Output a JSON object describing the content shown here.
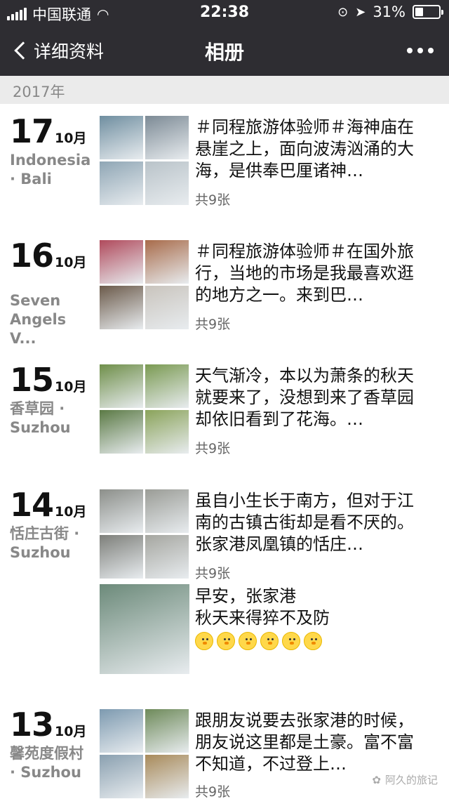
{
  "status": {
    "carrier": "中国联通",
    "time": "22:38",
    "battery": "31%"
  },
  "nav": {
    "back_label": "详细资料",
    "title": "相册"
  },
  "year": "2017年",
  "posts": [
    {
      "day": "17",
      "month": "10月",
      "location": "Indonesia · Bali",
      "text": "＃同程旅游体验师＃海神庙在悬崖之上，面向波涛汹涌的大海，是供奉巴厘诸神…",
      "count": "共9张",
      "photo_colors": [
        "#6f8ea0",
        "#7c8a95",
        "#8fa6b5",
        "#b9c3c9"
      ]
    },
    {
      "day": "16",
      "month": "10月",
      "location": "Seven Angels V...",
      "text": "＃同程旅游体验师＃在国外旅行，当地的市场是我最喜欢逛的地方之一。来到巴…",
      "count": "共9张",
      "photo_colors": [
        "#b04a5c",
        "#a86b4a",
        "#6b5a4a",
        "#c9c4bd"
      ]
    },
    {
      "day": "15",
      "month": "10月",
      "location": "香草园 · Suzhou",
      "text": "天气渐冷，本以为萧条的秋天就要来了，没想到来了香草园却依旧看到了花海。…",
      "count": "共9张",
      "photo_colors": [
        "#6f8f4a",
        "#7a9a52",
        "#5b7a45",
        "#8aa35a"
      ]
    },
    {
      "day": "14",
      "month": "10月",
      "location": "恬庄古街 · Suzhou",
      "text": "虽自小生长于南方，但对于江南的古镇古街却是看不厌的。张家港凤凰镇的恬庄…",
      "count": "共9张",
      "photo_colors": [
        "#8c8f8a",
        "#9a9c96",
        "#7d7f7a",
        "#a5a6a0"
      ],
      "extra_text_1": "早安，张家港",
      "extra_text_2": "秋天来得猝不及防",
      "extra_photo_color": "#6c8a7a"
    },
    {
      "day": "13",
      "month": "10月",
      "location": "馨苑度假村 · Suzhou",
      "text": "跟朋友说要去张家港的时候，朋友说这里都是土豪。富不富不知道，不过登上…",
      "count": "共9张",
      "photo_colors": [
        "#7d9ab0",
        "#6e8a5a",
        "#8aa0b0",
        "#a88a5a"
      ]
    }
  ],
  "watermark": "阿久的旅记"
}
